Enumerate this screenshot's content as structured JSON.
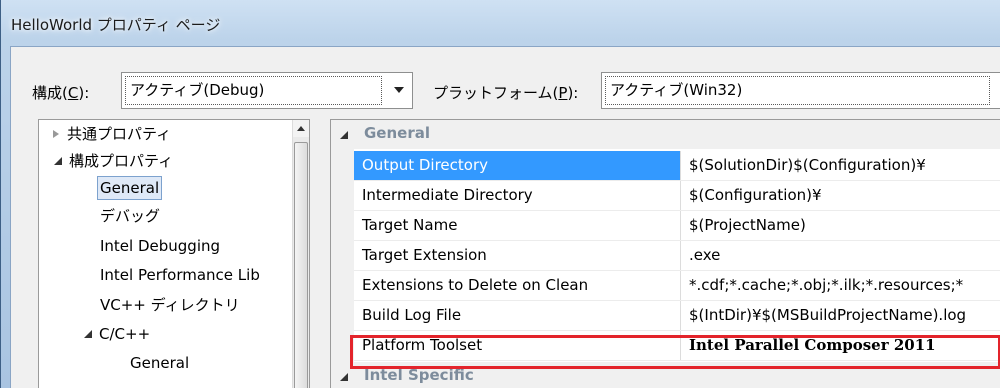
{
  "window": {
    "title": "HelloWorld プロパティ ページ"
  },
  "config": {
    "config_label_pre": "構成(",
    "config_label_key": "C",
    "config_label_post": "):",
    "config_value": "アクティブ(Debug)",
    "platform_label_pre": "プラットフォーム(",
    "platform_label_key": "P",
    "platform_label_post": "):",
    "platform_value": "アクティブ(Win32)"
  },
  "tree": {
    "items": [
      {
        "label": "共通プロパティ"
      },
      {
        "label": "構成プロパティ"
      },
      {
        "label": "General"
      },
      {
        "label": "デバッグ"
      },
      {
        "label": "Intel Debugging"
      },
      {
        "label": "Intel Performance Lib"
      },
      {
        "label": "VC++ ディレクトリ"
      },
      {
        "label": "C/C++"
      },
      {
        "label": "General"
      }
    ]
  },
  "grid": {
    "category_general": "General",
    "category_intel": "Intel Specific",
    "rows": [
      {
        "name": "Output Directory",
        "value": "$(SolutionDir)$(Configuration)¥"
      },
      {
        "name": "Intermediate Directory",
        "value": "$(Configuration)¥"
      },
      {
        "name": "Target Name",
        "value": "$(ProjectName)"
      },
      {
        "name": "Target Extension",
        "value": ".exe"
      },
      {
        "name": "Extensions to Delete on Clean",
        "value": "*.cdf;*.cache;*.obj;*.ilk;*.resources;*"
      },
      {
        "name": "Build Log File",
        "value": "$(IntDir)¥$(MSBuildProjectName).log"
      },
      {
        "name": "Platform Toolset",
        "value": "Intel Parallel Composer 2011"
      }
    ]
  },
  "colors": {
    "selection": "#3399ff",
    "highlight": "#e3242b",
    "category_text": "#7d8c9c"
  },
  "icons": {
    "collapsed": "triangle-right-icon",
    "expanded": "triangle-down-icon",
    "dropdown": "chevron-down-icon",
    "scroll_up": "arrow-up-icon"
  }
}
